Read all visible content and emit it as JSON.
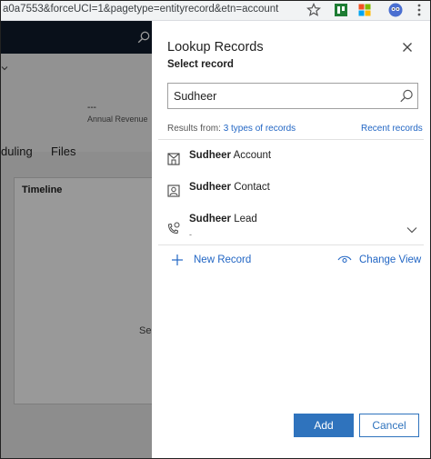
{
  "browser": {
    "url": "a0a7553&forceUCI=1&pagetype=entityrecord&etn=account"
  },
  "background": {
    "header_value": "---",
    "header_label": "Annual Revenue",
    "tab_partial": "duling",
    "tab_files": "Files",
    "timeline_label": "Timeline",
    "body_partial": "Sel"
  },
  "panel": {
    "title": "Lookup Records",
    "subtitle": "Select record",
    "search": {
      "value": "Sudheer",
      "placeholder": ""
    },
    "results_prefix": "Results from:",
    "results_types": "3 types of records",
    "recent_records": "Recent records",
    "results": [
      {
        "name": "Sudheer",
        "type": "Account",
        "icon": "account-icon"
      },
      {
        "name": "Sudheer",
        "type": "Contact",
        "icon": "contact-icon"
      },
      {
        "name": "Sudheer",
        "type": "Lead",
        "icon": "lead-icon",
        "sub": "-"
      }
    ],
    "new_record": "New Record",
    "change_view": "Change View",
    "add_label": "Add",
    "cancel_label": "Cancel"
  },
  "colors": {
    "accent": "#2f73bd",
    "link": "#2266c4",
    "nav": "#0f1c2c"
  }
}
